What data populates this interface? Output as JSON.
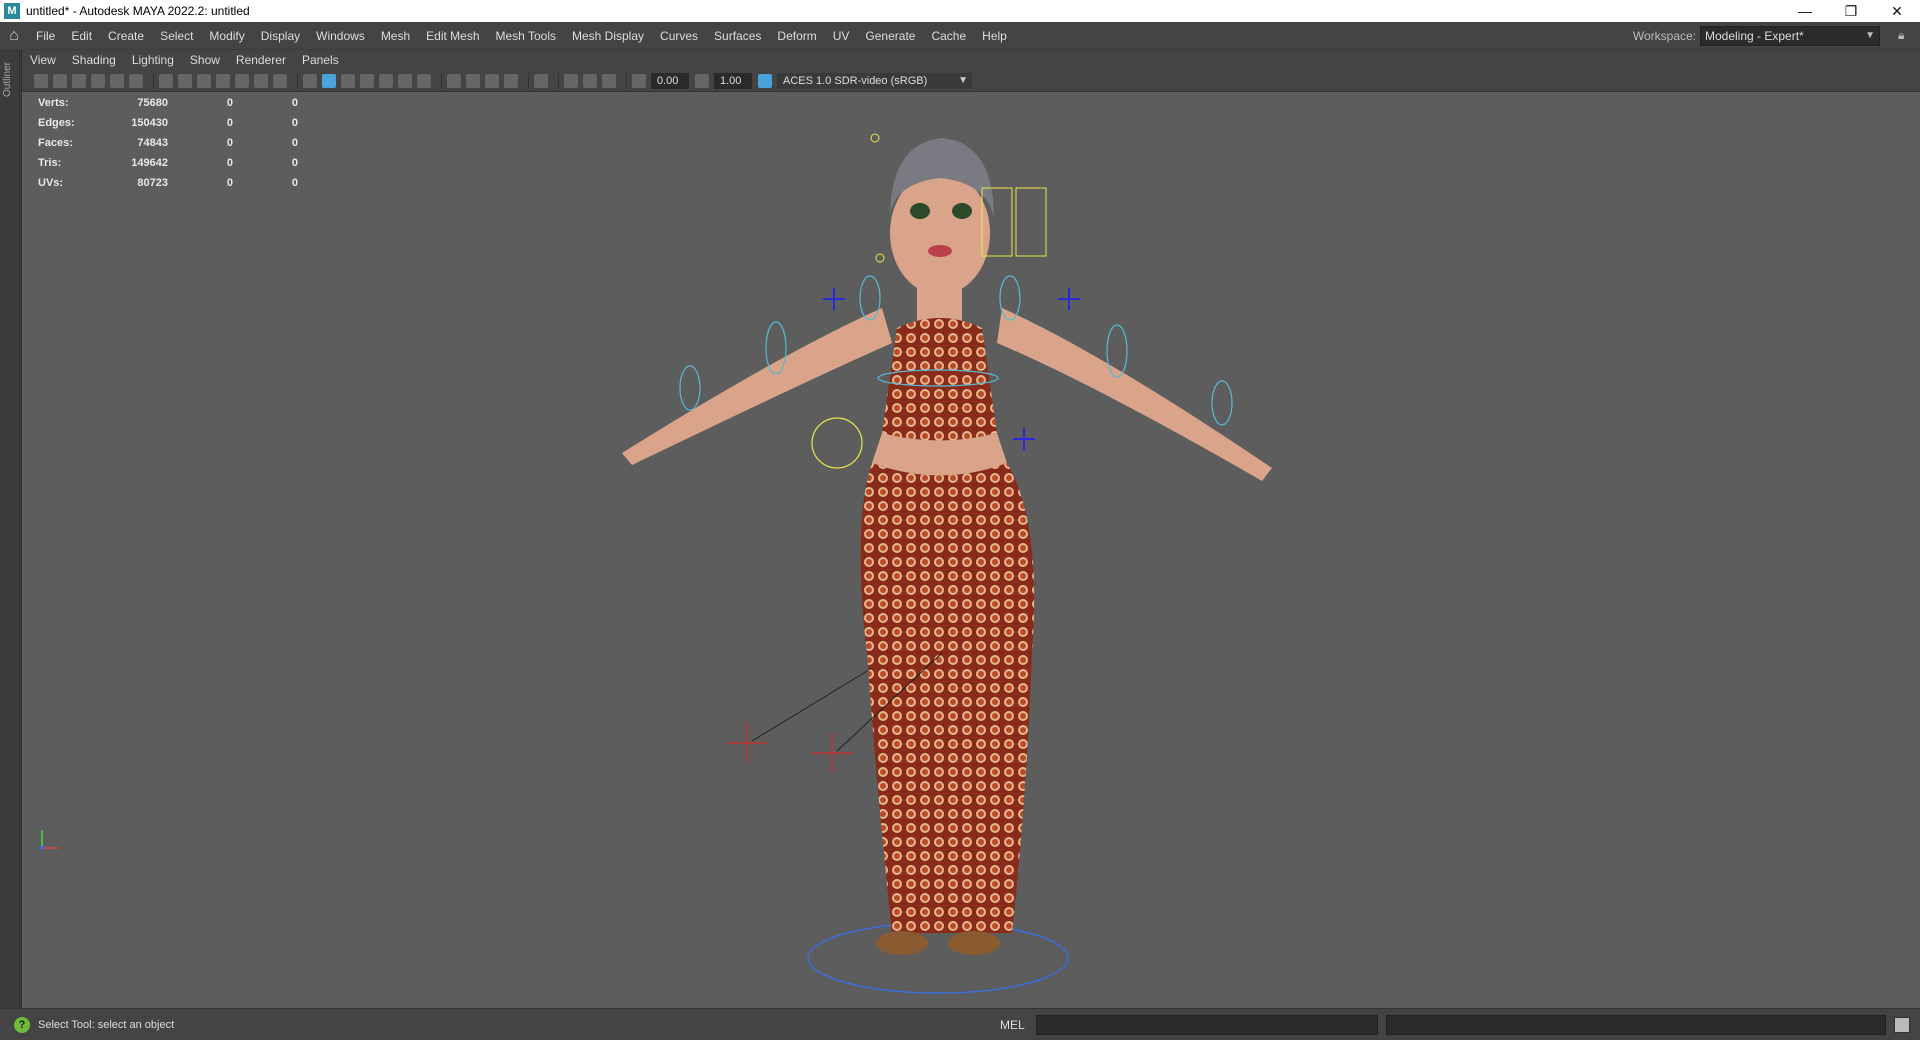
{
  "window": {
    "title": "untitled* - Autodesk MAYA 2022.2: untitled",
    "app_icon": "M",
    "controls": [
      "—",
      "❐",
      "✕"
    ]
  },
  "menubar": {
    "items": [
      "File",
      "Edit",
      "Create",
      "Select",
      "Modify",
      "Display",
      "Windows",
      "Mesh",
      "Edit Mesh",
      "Mesh Tools",
      "Mesh Display",
      "Curves",
      "Surfaces",
      "Deform",
      "UV",
      "Generate",
      "Cache",
      "Help"
    ],
    "workspace_label": "Workspace:",
    "workspace_value": "Modeling - Expert*"
  },
  "outliner": {
    "label": "Outliner"
  },
  "panel": {
    "menu": [
      "View",
      "Shading",
      "Lighting",
      "Show",
      "Renderer",
      "Panels"
    ],
    "toolbar": {
      "exposure": "0.00",
      "gamma": "1.00",
      "color_space": "ACES 1.0 SDR-video (sRGB)"
    }
  },
  "hud": {
    "rows": [
      {
        "label": "Verts:",
        "v1": "75680",
        "v2": "0",
        "v3": "0"
      },
      {
        "label": "Edges:",
        "v1": "150430",
        "v2": "0",
        "v3": "0"
      },
      {
        "label": "Faces:",
        "v1": "74843",
        "v2": "0",
        "v3": "0"
      },
      {
        "label": "Tris:",
        "v1": "149642",
        "v2": "0",
        "v3": "0"
      },
      {
        "label": "UVs:",
        "v1": "80723",
        "v2": "0",
        "v3": "0"
      }
    ]
  },
  "viewport": {
    "camera": "persp"
  },
  "statusbar": {
    "help_text": "Select Tool: select an object",
    "mel_label": "MEL"
  },
  "colors": {
    "viewport_bg": "#5d5d5d",
    "ui_bg": "#444444",
    "accent_blue": "#4aa3d8",
    "help_green": "#6fba3d"
  }
}
